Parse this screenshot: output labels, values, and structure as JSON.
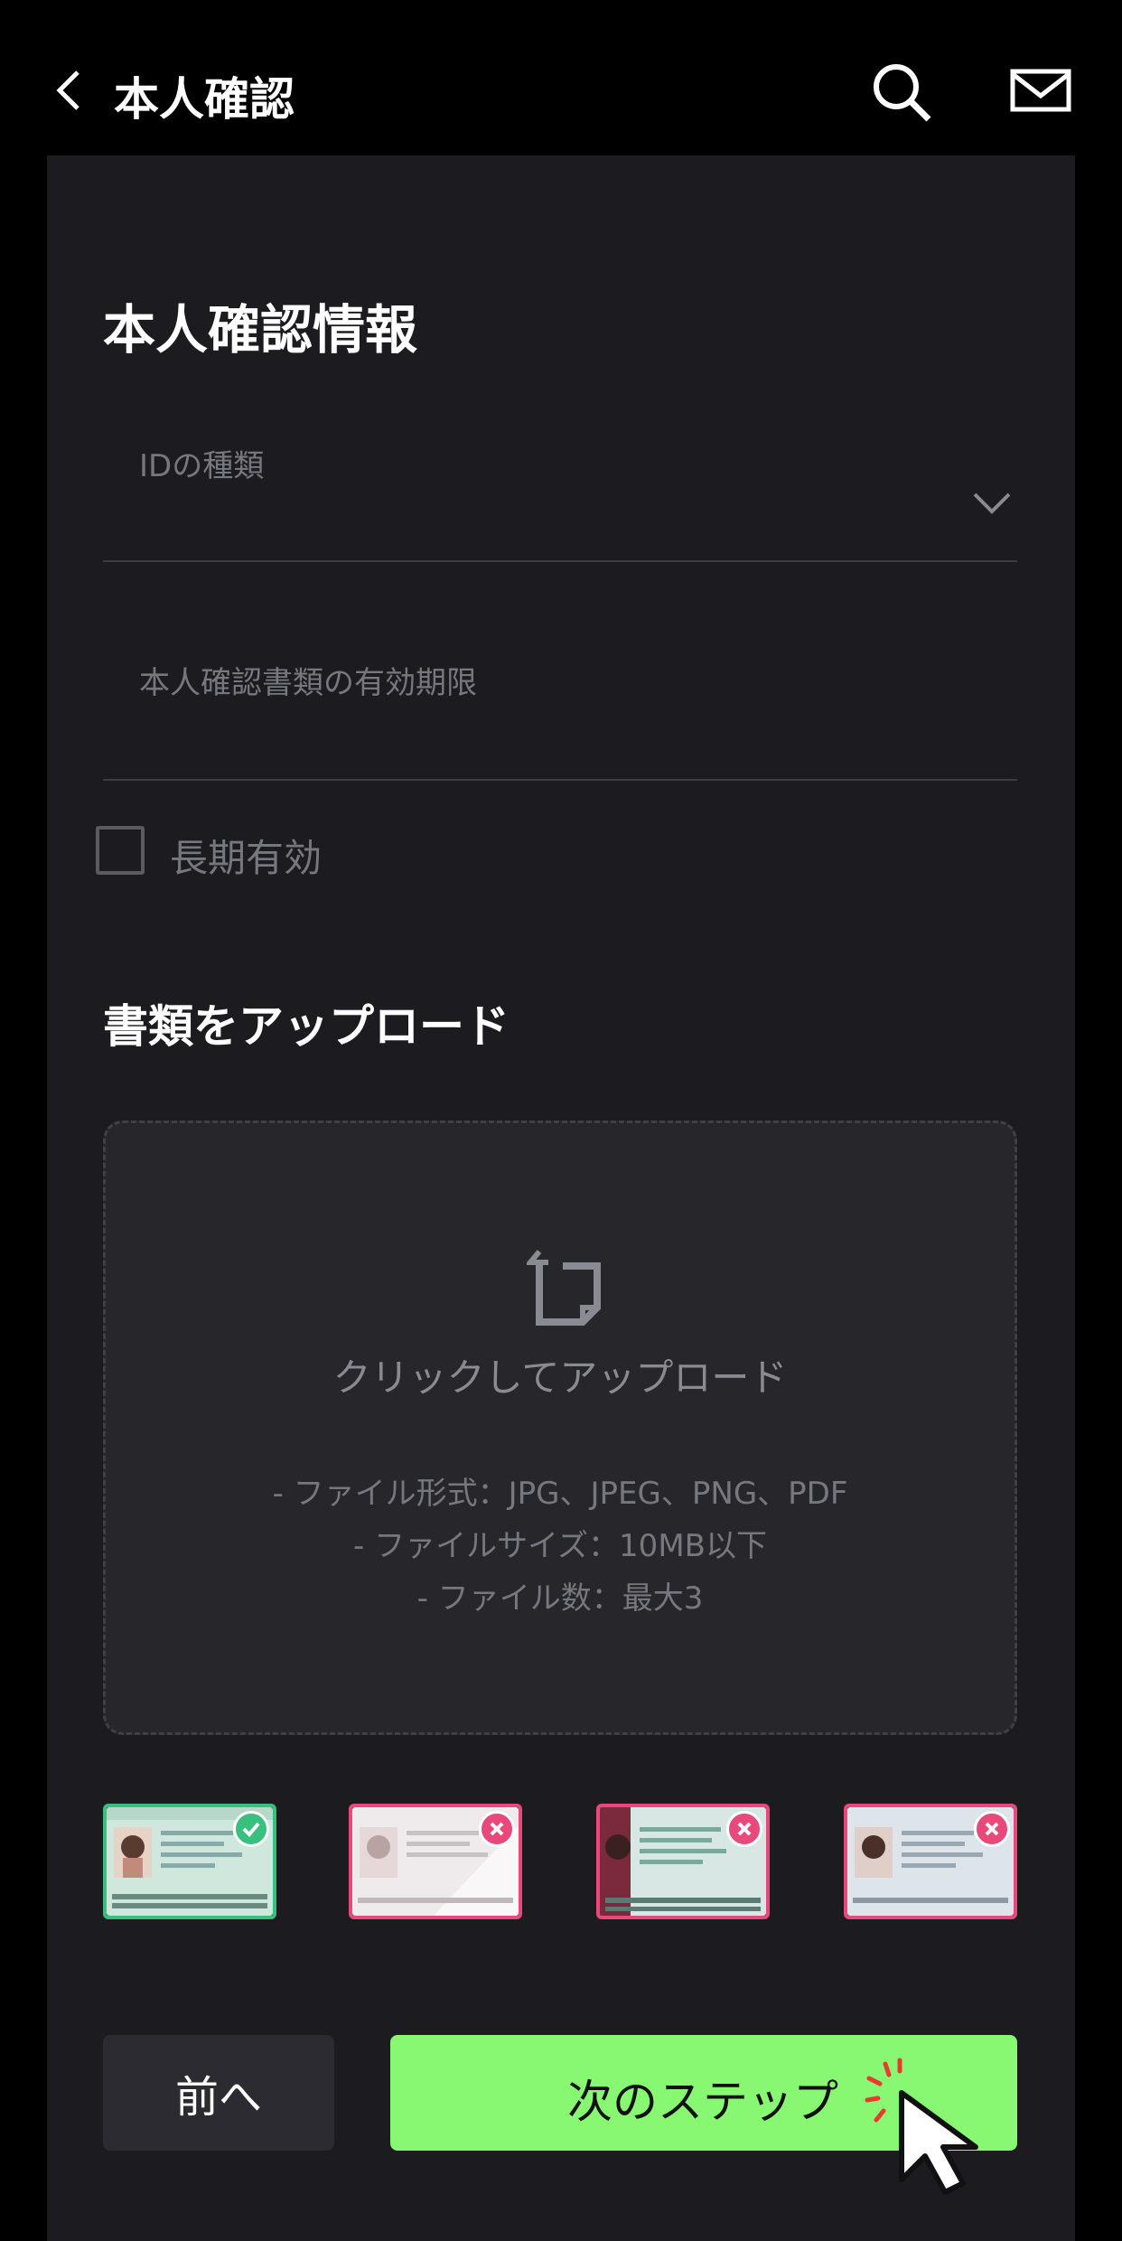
{
  "header": {
    "title": "本人確認"
  },
  "form": {
    "section_title": "本人確認情報",
    "id_type_label": "IDの種類",
    "expiry_label": "本人確認書類の有効期限",
    "long_term_label": "長期有効",
    "long_term_checked": false
  },
  "upload": {
    "section_title": "書類をアップロード",
    "cta": "クリックしてアップロード",
    "rules": [
      "- ファイル形式：JPG、JPEG、PNG、PDF",
      "- ファイルサイズ：10MB以下",
      "- ファイル数：最大3"
    ],
    "thumbnails": [
      {
        "status": "accepted",
        "icon": "check-icon"
      },
      {
        "status": "rejected",
        "icon": "close-icon"
      },
      {
        "status": "rejected",
        "icon": "close-icon"
      },
      {
        "status": "rejected",
        "icon": "close-icon"
      }
    ]
  },
  "actions": {
    "prev_label": "前へ",
    "next_label": "次のステップ"
  },
  "colors": {
    "accent_green": "#88f772",
    "success": "#37c07e",
    "error": "#e8497a",
    "panel": "#1c1c20",
    "background": "#000000"
  }
}
